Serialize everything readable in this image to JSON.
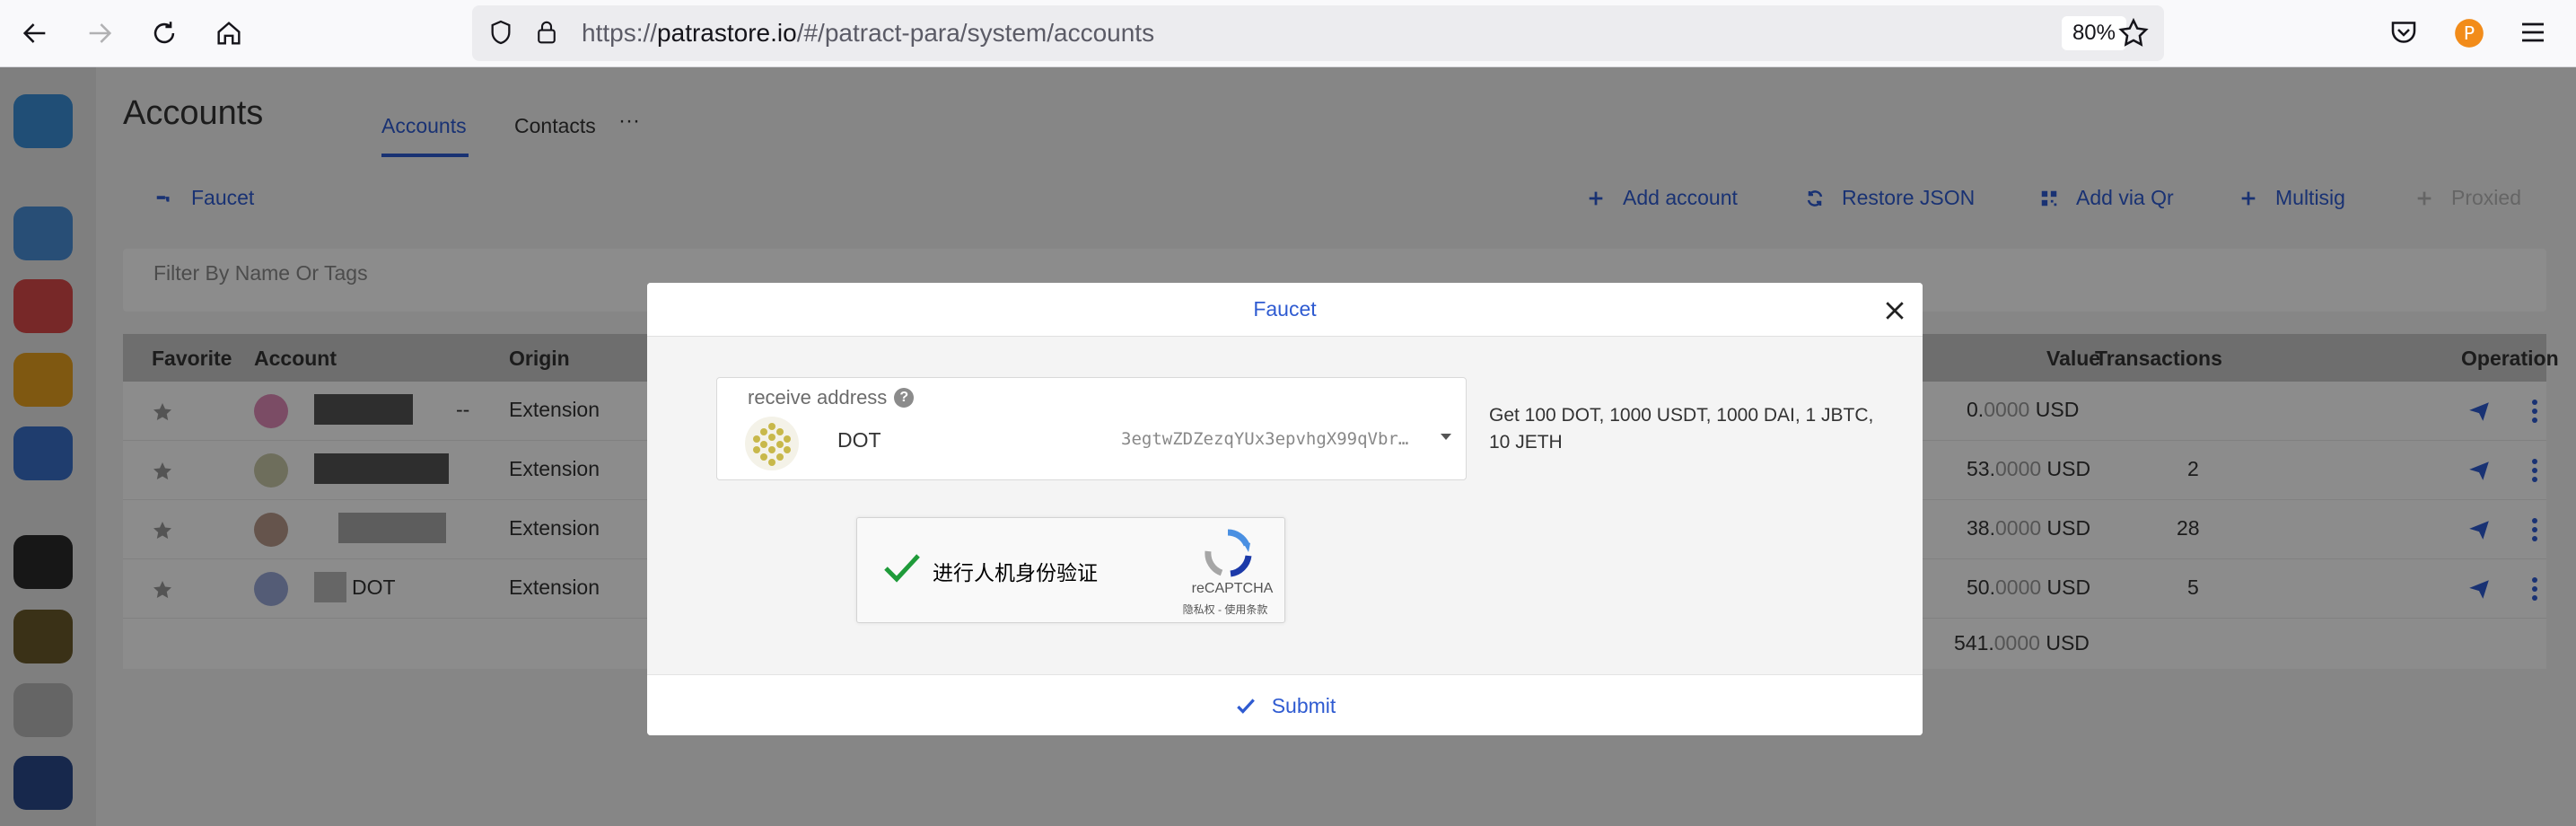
{
  "browser": {
    "url_prefix": "https://",
    "url_host": "patrastore.io",
    "url_path": "/#/patract-para/system/accounts",
    "zoom": "80%"
  },
  "page": {
    "title": "Accounts",
    "tabs": [
      "Accounts",
      "Contacts",
      "···"
    ],
    "toolbar": {
      "faucet": "Faucet",
      "add_account": "Add account",
      "restore_json": "Restore JSON",
      "add_via_qr": "Add via Qr",
      "multisig": "Multisig",
      "proxied": "Proxied"
    },
    "filter_placeholder": "Filter By Name Or Tags",
    "table": {
      "headers": {
        "favorite": "Favorite",
        "account": "Account",
        "origin": "Origin",
        "value": "Value",
        "transactions": "Transactions",
        "operation": "Operation"
      },
      "rows": [
        {
          "name_suffix": "--",
          "origin": "Extension",
          "value_int": "0.",
          "value_dec": "0000",
          "unit": "USD",
          "transactions": ""
        },
        {
          "name_suffix": "",
          "origin": "Extension",
          "value_int": "53.",
          "value_dec": "0000",
          "unit": "USD",
          "transactions": "2"
        },
        {
          "name_suffix": "",
          "origin": "Extension",
          "value_int": "38.",
          "value_dec": "0000",
          "unit": "USD",
          "transactions": "28"
        },
        {
          "name_suffix": "DOT",
          "origin": "Extension",
          "value_int": "50.",
          "value_dec": "0000",
          "unit": "USD",
          "transactions": "5"
        }
      ],
      "total": {
        "value_int": "541.",
        "value_dec": "0000",
        "unit": "USD"
      }
    }
  },
  "modal": {
    "title": "Faucet",
    "receive_label": "receive address",
    "account_name": "DOT",
    "address": "3egtwZDZezqYUx3epvhgX99qVbr…",
    "description": "Get 100 DOT, 1000 USDT, 1000 DAI, 1 JBTC, 10 JETH",
    "captcha_text": "进行人机身份验证",
    "captcha_brand": "reCAPTCHA",
    "captcha_terms": "隐私权 - 使用条款",
    "submit": "Submit"
  },
  "colors": {
    "accent": "#2f5bd1",
    "overlay": "rgba(0,0,0,0.45)"
  },
  "icons": [
    "back-arrow-icon",
    "forward-arrow-icon",
    "reload-icon",
    "home-icon",
    "shield-icon",
    "lock-icon",
    "star-icon",
    "pocket-icon",
    "profile-icon",
    "menu-icon",
    "close-icon",
    "checkmark-icon",
    "send-icon",
    "more-vertical-icon",
    "recaptcha-icon"
  ]
}
